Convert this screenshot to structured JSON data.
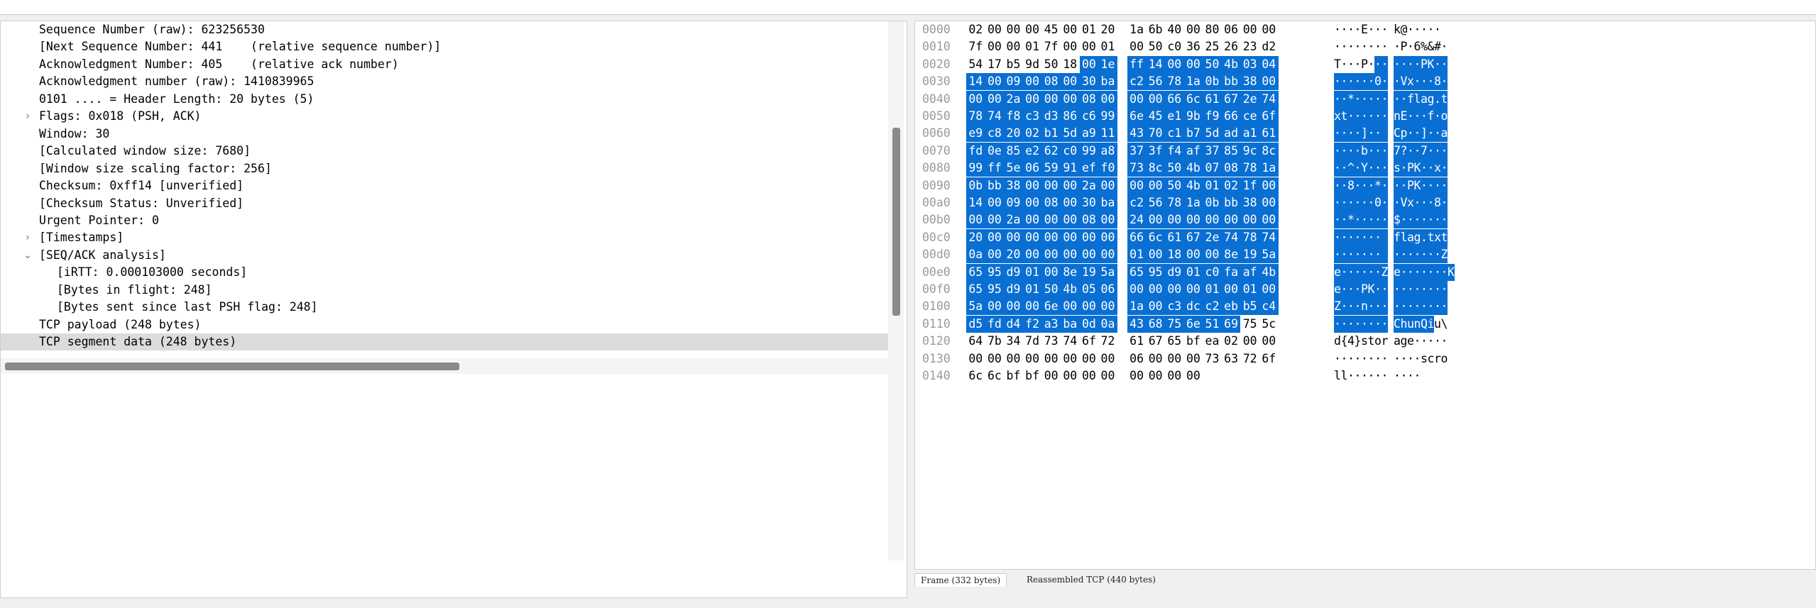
{
  "detail_tree": {
    "rows": [
      {
        "text": "Sequence Number (raw): 623256530",
        "indent": 1,
        "expander": ""
      },
      {
        "text": "[Next Sequence Number: 441    (relative sequence number)]",
        "indent": 1,
        "expander": ""
      },
      {
        "text": "Acknowledgment Number: 405    (relative ack number)",
        "indent": 1,
        "expander": ""
      },
      {
        "text": "Acknowledgment number (raw): 1410839965",
        "indent": 1,
        "expander": ""
      },
      {
        "text": "0101 .... = Header Length: 20 bytes (5)",
        "indent": 1,
        "expander": ""
      },
      {
        "text": "Flags: 0x018 (PSH, ACK)",
        "indent": 1,
        "expander": "collapsed"
      },
      {
        "text": "Window: 30",
        "indent": 1,
        "expander": ""
      },
      {
        "text": "[Calculated window size: 7680]",
        "indent": 1,
        "expander": ""
      },
      {
        "text": "[Window size scaling factor: 256]",
        "indent": 1,
        "expander": ""
      },
      {
        "text": "Checksum: 0xff14 [unverified]",
        "indent": 1,
        "expander": ""
      },
      {
        "text": "[Checksum Status: Unverified]",
        "indent": 1,
        "expander": ""
      },
      {
        "text": "Urgent Pointer: 0",
        "indent": 1,
        "expander": ""
      },
      {
        "text": "[Timestamps]",
        "indent": 1,
        "expander": "collapsed"
      },
      {
        "text": "[SEQ/ACK analysis]",
        "indent": 1,
        "expander": "expanded"
      },
      {
        "text": "[iRTT: 0.000103000 seconds]",
        "indent": 2,
        "expander": ""
      },
      {
        "text": "[Bytes in flight: 248]",
        "indent": 2,
        "expander": ""
      },
      {
        "text": "[Bytes sent since last PSH flag: 248]",
        "indent": 2,
        "expander": ""
      },
      {
        "text": "TCP payload (248 bytes)",
        "indent": 1,
        "expander": ""
      },
      {
        "text": "TCP segment data (248 bytes)",
        "indent": 1,
        "expander": "",
        "selected": true
      }
    ]
  },
  "hex_dump": {
    "selection": {
      "start": 38,
      "end": 285
    },
    "rows": [
      {
        "offset": "0000",
        "hex": "02 00 00 00 45 00 01 20 1a 6b 40 00 80 06 00 00",
        "ascii": "····E·· ·k@·····"
      },
      {
        "offset": "0010",
        "hex": "7f 00 00 01 7f 00 00 01 00 50 c0 36 25 26 23 d2",
        "ascii": "·········P·6%&#·"
      },
      {
        "offset": "0020",
        "hex": "54 17 b5 9d 50 18 00 1e ff 14 00 00 50 4b 03 04",
        "ascii": "T···P··· ····PK··"
      },
      {
        "offset": "0030",
        "hex": "14 00 09 00 08 00 30 ba c2 56 78 1a 0b bb 38 00",
        "ascii": "······0· ·Vx···8·"
      },
      {
        "offset": "0040",
        "hex": "00 00 2a 00 00 00 08 00 00 00 66 6c 61 67 2e 74",
        "ascii": "··*····· ··flag.t"
      },
      {
        "offset": "0050",
        "hex": "78 74 f8 c3 d3 86 c6 99 6e 45 e1 9b f9 66 ce 6f",
        "ascii": "xt······ nE···f·o"
      },
      {
        "offset": "0060",
        "hex": "e9 c8 20 02 b1 5d a9 11 43 70 c1 b7 5d ad a1 61",
        "ascii": "·· ··]·· Cp··]··a"
      },
      {
        "offset": "0070",
        "hex": "fd 0e 85 e2 62 c0 99 a8 37 3f f4 af 37 85 9c 8c",
        "ascii": "····b··· 7?··7···"
      },
      {
        "offset": "0080",
        "hex": "99 ff 5e 06 59 91 ef f0 73 8c 50 4b 07 08 78 1a",
        "ascii": "··^·Y··· s·PK··x·"
      },
      {
        "offset": "0090",
        "hex": "0b bb 38 00 00 00 2a 00 00 00 50 4b 01 02 1f 00",
        "ascii": "··8···*· ··PK····"
      },
      {
        "offset": "00a0",
        "hex": "14 00 09 00 08 00 30 ba c2 56 78 1a 0b bb 38 00",
        "ascii": "······0· ·Vx···8·"
      },
      {
        "offset": "00b0",
        "hex": "00 00 2a 00 00 00 08 00 24 00 00 00 00 00 00 00",
        "ascii": "··*····· $·······"
      },
      {
        "offset": "00c0",
        "hex": "20 00 00 00 00 00 00 00 66 6c 61 67 2e 74 78 74",
        "ascii": " ······· flag.txt"
      },
      {
        "offset": "00d0",
        "hex": "0a 00 20 00 00 00 00 00 01 00 18 00 00 8e 19 5a",
        "ascii": "·· ····· ·······Z"
      },
      {
        "offset": "00e0",
        "hex": "65 95 d9 01 00 8e 19 5a 65 95 d9 01 c0 fa af 4b",
        "ascii": "e······Z e·······K"
      },
      {
        "offset": "00f0",
        "hex": "65 95 d9 01 50 4b 05 06 00 00 00 00 01 00 01 00",
        "ascii": "e···PK·· ········"
      },
      {
        "offset": "0100",
        "hex": "5a 00 00 00 6e 00 00 00 1a 00 c3 dc c2 eb b5 c4",
        "ascii": "Z···n··· ········"
      },
      {
        "offset": "0110",
        "hex": "d5 fd d4 f2 a3 ba 0d 0a 43 68 75 6e 51 69 75 5c",
        "ascii": "········ ChunQiu\\"
      },
      {
        "offset": "0120",
        "hex": "64 7b 34 7d 73 74 6f 72 61 67 65 bf ea 02 00 00",
        "ascii": "d{4}stor age·····"
      },
      {
        "offset": "0130",
        "hex": "00 00 00 00 00 00 00 00 06 00 00 00 73 63 72 6f",
        "ascii": "········ ····scro"
      },
      {
        "offset": "0140",
        "hex": "6c 6c bf bf 00 00 00 00 00 00 00 00",
        "ascii": "ll······ ····"
      }
    ]
  },
  "byte_tabs": [
    {
      "label": "Frame (332 bytes)",
      "active": true
    },
    {
      "label": "Reassembled TCP (440 bytes)",
      "active": false
    }
  ],
  "colors": {
    "selection": "#0a6fd3",
    "offset_text": "#9a9a9a",
    "tree_selection": "#dcdcdc"
  }
}
